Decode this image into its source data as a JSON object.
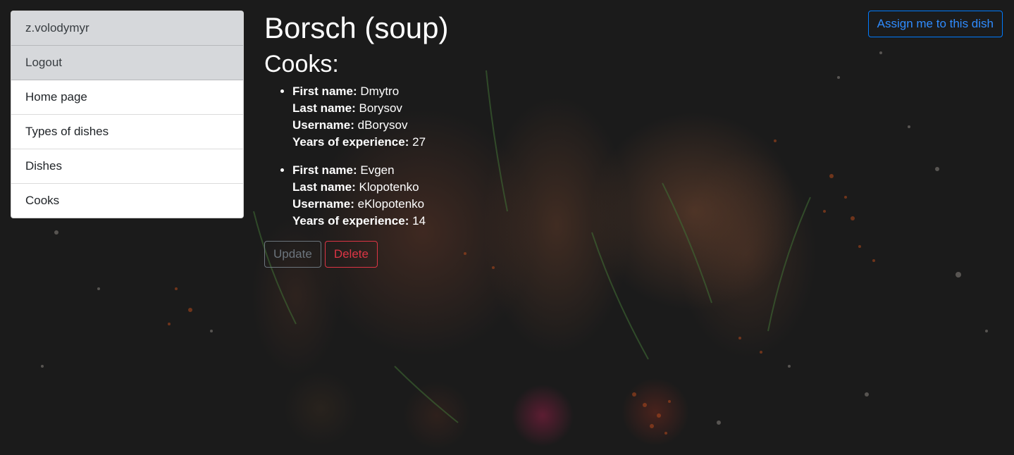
{
  "sidebar": {
    "items": [
      {
        "label": "z.volodymyr",
        "variant": "muted"
      },
      {
        "label": "Logout",
        "variant": "muted"
      },
      {
        "label": "Home page",
        "variant": "default"
      },
      {
        "label": "Types of dishes",
        "variant": "default"
      },
      {
        "label": "Dishes",
        "variant": "default"
      },
      {
        "label": "Cooks",
        "variant": "default"
      }
    ]
  },
  "dish": {
    "title": "Borsch (soup)",
    "cooks_heading": "Cooks:"
  },
  "labels": {
    "first_name": "First name:",
    "last_name": "Last name:",
    "username": "Username:",
    "experience": "Years of experience:"
  },
  "cooks": [
    {
      "first_name": "Dmytro",
      "last_name": "Borysov",
      "username": "dBorysov",
      "experience": "27"
    },
    {
      "first_name": "Evgen",
      "last_name": "Klopotenko",
      "username": "eKlopotenko",
      "experience": "14"
    }
  ],
  "actions": {
    "update_label": "Update",
    "delete_label": "Delete",
    "assign_label": "Assign me to this dish"
  },
  "colors": {
    "background": "#1b1b1b",
    "primary": "#007bff",
    "danger": "#dc3545",
    "secondary": "#6c757d"
  }
}
